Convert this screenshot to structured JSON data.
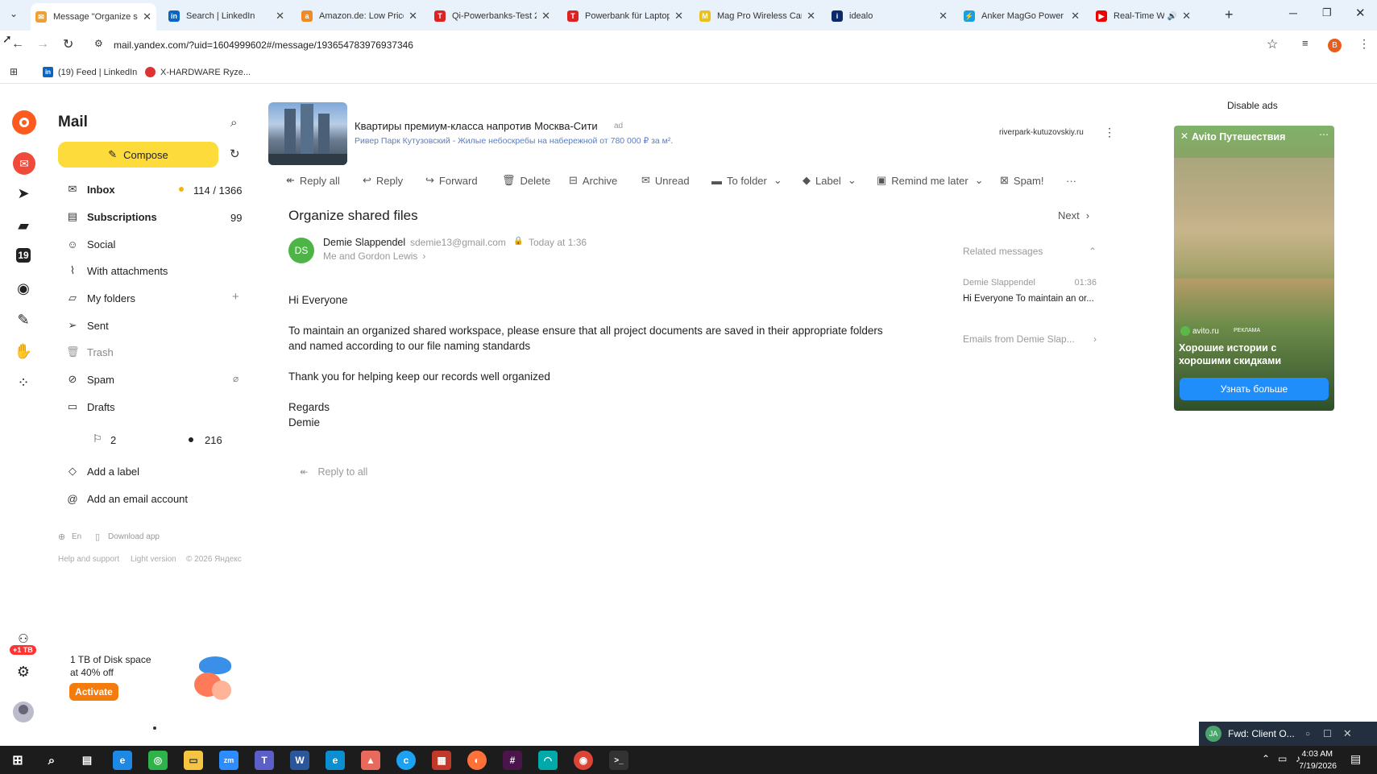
{
  "tabs": [
    {
      "title": "Message \"Organize s",
      "icon": "yandex-mail-icon",
      "color": "#f0a030"
    },
    {
      "title": "Search | LinkedIn",
      "icon": "linkedin-icon",
      "color": "#0a66c2"
    },
    {
      "title": "Amazon.de: Low Price",
      "icon": "amazon-icon",
      "color": "#f08a24"
    },
    {
      "title": "Qi-Powerbanks-Test 2",
      "icon": "test-site-icon",
      "color": "#d22"
    },
    {
      "title": "Powerbank für Laptop",
      "icon": "test-site-icon",
      "color": "#d22"
    },
    {
      "title": "Mag Pro Wireless Car",
      "icon": "mag-icon",
      "color": "#e8c21b"
    },
    {
      "title": "idealo",
      "icon": "idealo-icon",
      "color": "#0a2a6c"
    },
    {
      "title": "Anker MagGo Power",
      "icon": "anker-icon",
      "color": "#18a0e0"
    },
    {
      "title": "Real-Time WebSc",
      "icon": "youtube-icon",
      "color": "#e00"
    }
  ],
  "address": {
    "url": "mail.yandex.com/?uid=1604999602#/message/193654783976937346"
  },
  "bookmarks": [
    {
      "label": "(19) Feed | LinkedIn",
      "icon": "linkedin-icon"
    },
    {
      "label": "X-HARDWARE Ryze...",
      "icon": "x-hardware-icon"
    }
  ],
  "profile_initial": "B",
  "sidebar": {
    "title": "Mail",
    "compose_label": "Compose",
    "items": [
      {
        "label": "Inbox",
        "count": "114 / 1366",
        "icon": "inbox-icon",
        "bold": true
      },
      {
        "label": "Subscriptions",
        "count": "99",
        "icon": "subscriptions-icon",
        "bold": true
      },
      {
        "label": "Social",
        "count": "",
        "icon": "social-icon"
      },
      {
        "label": "With attachments",
        "count": "",
        "icon": "paperclip-icon"
      },
      {
        "label": "My folders",
        "count": "",
        "icon": "folder-icon"
      },
      {
        "label": "Sent",
        "count": "",
        "icon": "sent-icon"
      },
      {
        "label": "Trash",
        "count": "",
        "icon": "trash-icon"
      },
      {
        "label": "Spam",
        "count": "",
        "icon": "spam-icon"
      },
      {
        "label": "Drafts",
        "count": "",
        "icon": "drafts-icon"
      }
    ],
    "bookmarked_count": "2",
    "unread_count": "216",
    "add_label": "Add a label",
    "add_account": "Add an email account",
    "lang": "En",
    "download_app": "Download app",
    "help": "Help and support",
    "light_version": "Light version",
    "copyright": "© 2026 Яндекс",
    "promo_line1": "1 TB of Disk space",
    "promo_line2": "at 40% off",
    "promo_button": "Activate",
    "rail_badge": "+1 TB"
  },
  "ad_banner": {
    "title": "Квартиры премиум-класса напротив Москва-Сити",
    "ad_marker": "ad",
    "subtitle": "Ривер Парк Кутузовский - Жилые небоскребы на набережной от 780 000 ₽ за м².",
    "domain": "riverpark-kutuzovskiy.ru"
  },
  "toolbar": {
    "reply_all": "Reply all",
    "reply": "Reply",
    "forward": "Forward",
    "delete": "Delete",
    "archive": "Archive",
    "unread": "Unread",
    "to_folder": "To folder",
    "label": "Label",
    "remind": "Remind me later",
    "spam": "Spam!",
    "more": "···"
  },
  "message": {
    "subject": "Organize shared files",
    "next_label": "Next",
    "sender_initials": "DS",
    "sender_name": "Demie Slappendel",
    "sender_email": "sdemie13@gmail.com",
    "time": "Today at 1:36",
    "recipients": "Me and Gordon Lewis",
    "body": [
      "Hi Everyone",
      "To maintain an organized shared workspace, please ensure that all project documents are saved in their appropriate folders",
      "and named according to our file naming standards",
      "Thank you for helping keep our records well organized",
      "Regards",
      "Demie"
    ],
    "reply_all_action": "Reply to all"
  },
  "related": {
    "header": "Related messages",
    "item_sender": "Demie Slappendel",
    "item_time": "01:36",
    "item_preview": "Hi Everyone To maintain an or...",
    "emails_from": "Emails from Demie Slap..."
  },
  "right_ad": {
    "disable_ads": "Disable ads",
    "brand": "Avito Путешествия",
    "brand_small": "avito.ru",
    "ad_tag": "РЕКЛАМА",
    "headline": "Хорошие истории с хорошими скидками",
    "button": "Узнать больше"
  },
  "chat_popup": {
    "initials": "JA",
    "title": "Fwd: Client O..."
  },
  "taskbar": {
    "time": "4:03 AM",
    "date": "7/19/2026"
  }
}
